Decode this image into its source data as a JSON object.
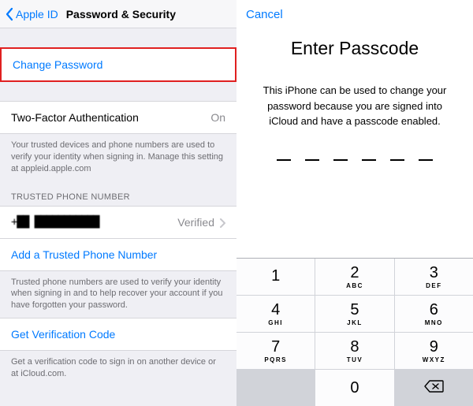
{
  "nav": {
    "back_label": "Apple ID",
    "title": "Password & Security"
  },
  "change_password": {
    "label": "Change Password"
  },
  "two_factor": {
    "label": "Two-Factor Authentication",
    "value": "On"
  },
  "two_factor_footer": "Your trusted devices and phone numbers are used to verify your identity when signing in. Manage this setting at appleid.apple.com",
  "trusted_header": "TRUSTED PHONE NUMBER",
  "trusted_phone": {
    "number": "+██ ███████████",
    "status": "Verified"
  },
  "add_phone": {
    "label": "Add a Trusted Phone Number"
  },
  "trusted_footer": "Trusted phone numbers are used to verify your identity when signing in and to help recover your account if you have forgotten your password.",
  "verification": {
    "label": "Get Verification Code"
  },
  "verification_footer": "Get a verification code to sign in on another device or at iCloud.com.",
  "passcode": {
    "cancel": "Cancel",
    "title": "Enter Passcode",
    "message": "This iPhone can be used to change your password because you are signed into iCloud and have a passcode enabled."
  },
  "keys": {
    "k1": {
      "n": "1",
      "l": ""
    },
    "k2": {
      "n": "2",
      "l": "ABC"
    },
    "k3": {
      "n": "3",
      "l": "DEF"
    },
    "k4": {
      "n": "4",
      "l": "GHI"
    },
    "k5": {
      "n": "5",
      "l": "JKL"
    },
    "k6": {
      "n": "6",
      "l": "MNO"
    },
    "k7": {
      "n": "7",
      "l": "PQRS"
    },
    "k8": {
      "n": "8",
      "l": "TUV"
    },
    "k9": {
      "n": "9",
      "l": "WXYZ"
    },
    "k0": {
      "n": "0",
      "l": ""
    }
  }
}
